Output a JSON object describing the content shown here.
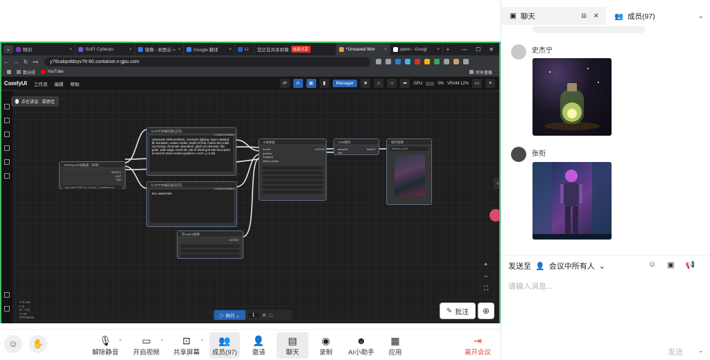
{
  "browser": {
    "tabs": [
      {
        "label": "物训",
        "color": "#7a3cb8"
      },
      {
        "label": "SciFi Cyberpu",
        "color": "#6a5acd"
      },
      {
        "label": "镜像 - 杭图云 >",
        "color": "#2c7be5"
      },
      {
        "label": "Google 翻译",
        "color": "#4285f4"
      },
      {
        "label": "Li",
        "color": "#2c5fbf"
      },
      {
        "label": "您正在共享屏幕",
        "color": "#888888"
      },
      {
        "label": "*Unsaved Wor",
        "color": "#d9a441",
        "active": true
      },
      {
        "label": "qwen - Googl",
        "color": "#ffffff"
      }
    ],
    "share_badge": "结束共享",
    "url": "y76calqvddxyv7tt-80.container.x-gpu.com",
    "bookmarks": [
      {
        "label": "数分段",
        "color": "#888888"
      },
      {
        "label": "YouTube",
        "color": "#ff0000"
      }
    ],
    "bookmarks_right": "所有書籤"
  },
  "comfy": {
    "logo": "ComfyUI",
    "menu": [
      "工作流",
      "编辑",
      "帮助"
    ],
    "manager_label": "Manager",
    "gpu_label": "GPU",
    "gpu_value": "0%",
    "vram_label": "VRAM 12%",
    "speaking_label": "正在讲话:",
    "speaking_name": "梁思佳",
    "nodes": {
      "checkpoint": {
        "title": "Checkpoint加载器（简易）",
        "outputs": [
          "MODEL",
          "CLIP",
          "VAE"
        ],
        "widget": "ckpt_name   SDXL\\sd_xl_base_1.0.safetensors"
      },
      "pos_prompt": {
        "title": "CLIP文本编码器(正向)",
        "badge": "CONDITIONING",
        "text": "cyberpunk 2099 aesthetic, cinematic lighting, hyper-detailed, 8k resolution, octane render, depth of field, motion blur trails, ray tracing, chromatic aberration, glitch art elements, film grain, wide-angle, Dutch tilt, rule of thirds grid with focal point at neon-lit street vendor (position x=0.67, y=0.33)"
      },
      "neg_prompt": {
        "title": "CLIP文本编码器(反向)",
        "badge": "CONDITIONING",
        "text": "text, watermark"
      },
      "ksampler": {
        "title": "K采样器",
        "id": "3",
        "inputs": [
          "model",
          "positive",
          "negative",
          "latent_image"
        ],
        "output": "LATENT",
        "widgets": [
          "seed",
          "control_after_generate",
          "steps",
          "cfg",
          "sampler_name",
          "scheduler",
          "denoise"
        ]
      },
      "vae_decode": {
        "title": "VAE解码",
        "inputs": [
          "samples",
          "vae"
        ],
        "output": "IMAGE"
      },
      "save_image": {
        "title": "保存图像",
        "widget": "filename_prefix",
        "value": "ComfyUI"
      },
      "empty_latent": {
        "title": "空Latent图像",
        "output": "LATENT",
        "widgets": [
          "width",
          "height",
          "batch_size"
        ]
      }
    },
    "run_label": "执行",
    "run_count": "1",
    "stats": [
      "T: 0.16s",
      "I: 0",
      "N: 7 [7]",
      "V: 20",
      "FPS:59.52"
    ],
    "annotate_label": "批注"
  },
  "meeting_bar": [
    {
      "label": "解除静音",
      "icon": "mic-off-icon"
    },
    {
      "label": "开启视频",
      "icon": "video-off-icon"
    },
    {
      "label": "共享屏幕",
      "icon": "share-screen-icon"
    },
    {
      "label": "成员(97)",
      "icon": "members-icon"
    },
    {
      "label": "邀请",
      "icon": "invite-icon"
    },
    {
      "label": "聊天",
      "icon": "chat-icon"
    },
    {
      "label": "录制",
      "icon": "record-icon"
    },
    {
      "label": "AI小助手",
      "icon": "ai-assistant-icon"
    },
    {
      "label": "应用",
      "icon": "apps-icon"
    },
    {
      "label": "离开会议",
      "icon": "leave-icon"
    }
  ],
  "chat_panel": {
    "tab_chat": "聊天",
    "tab_members": "成员(97)",
    "messages": [
      {
        "sender": "史杰宁",
        "image": "glowing-plant-in-jar-image"
      },
      {
        "sender": "张衔",
        "image": "cyberpunk-robot-image"
      }
    ],
    "send_to_label": "发送至",
    "send_to_target": "会议中所有人",
    "input_placeholder": "请输入消息...",
    "send_label": "发送"
  },
  "colors": {
    "share_border": "#3ec46d",
    "comfy_blue": "#2864b4",
    "leave_red": "#e04a2f"
  }
}
